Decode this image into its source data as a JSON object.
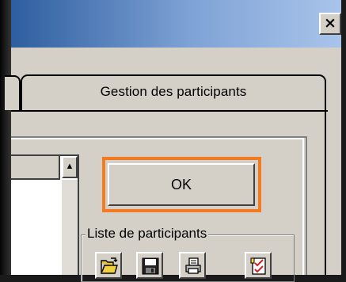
{
  "window": {
    "close_glyph": "×"
  },
  "tabs": [
    {
      "label": "Gestion des participants"
    }
  ],
  "list": {
    "scroll_up_glyph": "▲"
  },
  "ok_button": {
    "label": "OK",
    "highlight_color": "#f47a20"
  },
  "participants_group": {
    "label": "Liste de participants",
    "tools": [
      {
        "icon": "open-folder-icon"
      },
      {
        "icon": "save-disk-icon"
      },
      {
        "icon": "print-icon"
      },
      {
        "icon": "checklist-icon"
      }
    ]
  },
  "colors": {
    "titlebar_start": "#2e5e9f",
    "titlebar_end": "#a9c4ea",
    "dialog_bg": "#d4d0c8"
  }
}
